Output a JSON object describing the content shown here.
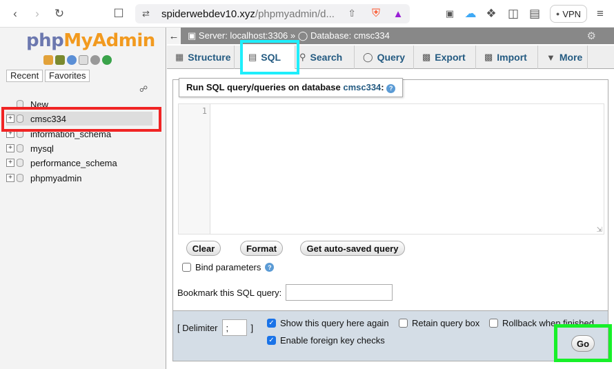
{
  "browser": {
    "url_domain": "spiderwebdev10.xyz",
    "url_path": "/phpmyadmin/d...",
    "vpn_label": "VPN"
  },
  "sidebar": {
    "logo_php": "php",
    "logo_admin": "MyAdmin",
    "recent_label": "Recent",
    "favorites_label": "Favorites",
    "tree": [
      {
        "label": "New"
      },
      {
        "label": "cmsc334"
      },
      {
        "label": "information_schema"
      },
      {
        "label": "mysql"
      },
      {
        "label": "performance_schema"
      },
      {
        "label": "phpmyadmin"
      }
    ]
  },
  "topbar": {
    "server": "Server: localhost:3306",
    "separator": "»",
    "database": "Database: cmsc334"
  },
  "tabs": [
    {
      "label": "Structure"
    },
    {
      "label": "SQL"
    },
    {
      "label": "Search"
    },
    {
      "label": "Query"
    },
    {
      "label": "Export"
    },
    {
      "label": "Import"
    },
    {
      "label": "More"
    }
  ],
  "sql_panel": {
    "legend_prefix": "Run SQL query/queries on database",
    "legend_db": "cmsc334",
    "legend_suffix": ":",
    "line_number": "1",
    "clear_label": "Clear",
    "format_label": "Format",
    "autosaved_label": "Get auto-saved query",
    "bind_params_label": "Bind parameters",
    "bookmark_label": "Bookmark this SQL query:",
    "bookmark_value": ""
  },
  "footer": {
    "delimiter_open": "[ Delimiter",
    "delimiter_value": ";",
    "delimiter_close": "]",
    "show_query_label": "Show this query here again",
    "retain_query_label": "Retain query box",
    "rollback_label": "Rollback when finished",
    "foreign_keys_label": "Enable foreign key checks",
    "go_label": "Go"
  },
  "colors": {
    "highlight_red": "#f02424",
    "highlight_cyan": "#1eeefb",
    "highlight_green": "#17f029",
    "link_blue": "#235a81"
  }
}
